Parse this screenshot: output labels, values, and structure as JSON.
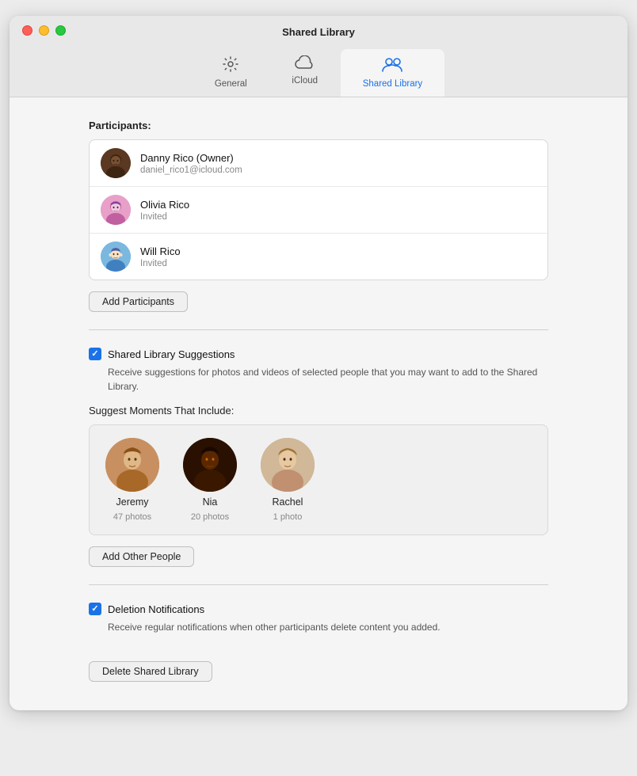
{
  "window": {
    "title": "Shared Library"
  },
  "tabs": [
    {
      "id": "general",
      "label": "General",
      "icon": "⚙️",
      "active": false
    },
    {
      "id": "icloud",
      "label": "iCloud",
      "icon": "☁️",
      "active": false
    },
    {
      "id": "shared-library",
      "label": "Shared Library",
      "icon": "👥",
      "active": true
    }
  ],
  "participants_label": "Participants:",
  "participants": [
    {
      "name": "Danny Rico (Owner)",
      "sub": "daniel_rico1@icloud.com",
      "avatar_type": "danny"
    },
    {
      "name": "Olivia Rico",
      "sub": "Invited",
      "avatar_type": "olivia"
    },
    {
      "name": "Will Rico",
      "sub": "Invited",
      "avatar_type": "will"
    }
  ],
  "add_participants_label": "Add Participants",
  "shared_library_suggestions": {
    "checkbox_label": "Shared Library Suggestions",
    "description": "Receive suggestions for photos and videos of selected people that you\nmay want to add to the Shared Library.",
    "suggest_moments_label": "Suggest Moments That Include:",
    "people": [
      {
        "name": "Jeremy",
        "count": "47 photos"
      },
      {
        "name": "Nia",
        "count": "20 photos"
      },
      {
        "name": "Rachel",
        "count": "1 photo"
      }
    ]
  },
  "add_other_people_label": "Add Other People",
  "deletion_notifications": {
    "checkbox_label": "Deletion Notifications",
    "description": "Receive regular notifications when other participants delete content\nyou added."
  },
  "delete_shared_library_label": "Delete Shared Library",
  "colors": {
    "accent": "#1a72e8",
    "checkbox": "#1a72e8"
  }
}
